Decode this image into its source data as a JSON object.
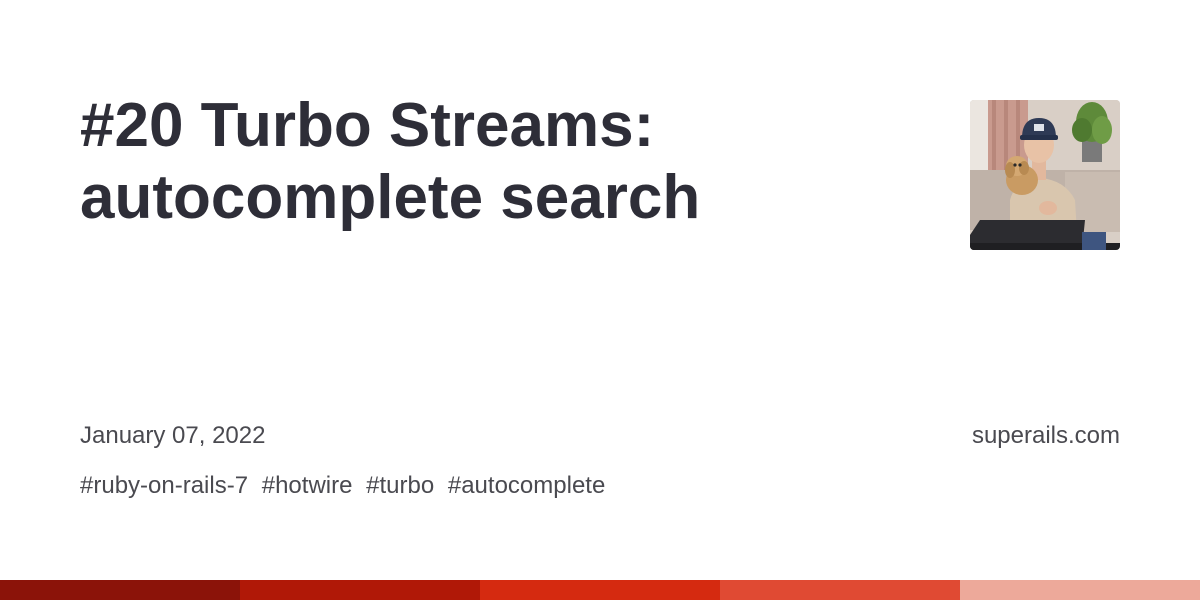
{
  "card": {
    "title_line1": "#20 Turbo Streams:",
    "title_line2": "autocomplete search",
    "date": "January 07, 2022",
    "site": "superails.com",
    "tags": [
      "#ruby-on-rails-7",
      "#hotwire",
      "#turbo",
      "#autocomplete"
    ]
  },
  "avatar": {
    "icon": "author-photo"
  },
  "strip": {
    "colors": [
      "#8b1309",
      "#b01807",
      "#d52a10",
      "#e04a33",
      "#eda99a"
    ]
  }
}
